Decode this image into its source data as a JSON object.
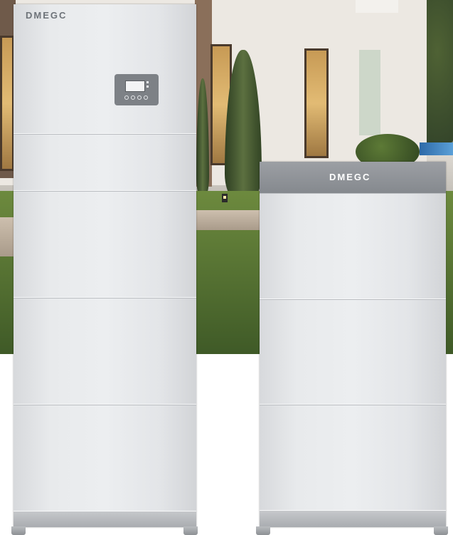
{
  "scene": {
    "description_free": true
  },
  "products": {
    "left_unit": {
      "brand": "DMEGC",
      "module_count": 4
    },
    "right_unit": {
      "brand": "DMEGC",
      "module_count": 3
    }
  },
  "colors": {
    "unit_body": "#e8eaec",
    "cap_gray": "#8d9196",
    "panel_gray": "#7d8186"
  }
}
